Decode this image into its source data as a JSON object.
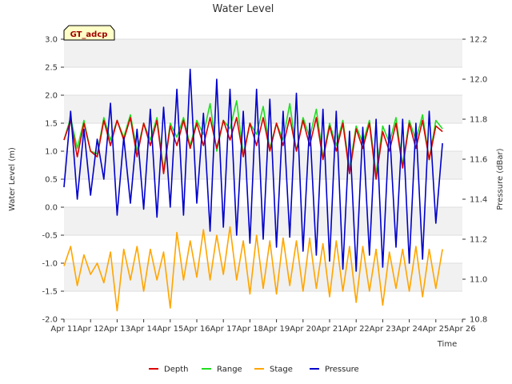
{
  "chart_data": {
    "type": "line",
    "title": "Water Level",
    "badge": "GT_adcp",
    "xlabel": "Time",
    "ylabel": "Water Level (m)",
    "y2label": "Pressure (dBar)",
    "ylim": [
      -2.0,
      3.0
    ],
    "y2lim": [
      10.8,
      12.2
    ],
    "xlim": [
      0,
      15
    ],
    "x_ticks": [
      "Apr 11",
      "Apr 12",
      "Apr 13",
      "Apr 14",
      "Apr 15",
      "Apr 16",
      "Apr 17",
      "Apr 18",
      "Apr 19",
      "Apr 20",
      "Apr 21",
      "Apr 22",
      "Apr 23",
      "Apr 24",
      "Apr 25",
      "Apr 26"
    ],
    "y_ticks": [
      "-2.0",
      "-1.5",
      "-1.0",
      "-0.5",
      "0.0",
      "0.5",
      "1.0",
      "1.5",
      "2.0",
      "2.5",
      "3.0"
    ],
    "y2_ticks": [
      "10.8",
      "11.0",
      "11.2",
      "11.4",
      "11.6",
      "11.8",
      "12.0",
      "12.2"
    ],
    "grid": "banded",
    "legend_position": "bottom",
    "series_x": [
      0.0,
      0.25,
      0.5,
      0.75,
      1.0,
      1.25,
      1.5,
      1.75,
      2.0,
      2.25,
      2.5,
      2.75,
      3.0,
      3.25,
      3.5,
      3.75,
      4.0,
      4.25,
      4.5,
      4.75,
      5.0,
      5.25,
      5.5,
      5.75,
      6.0,
      6.25,
      6.5,
      6.75,
      7.0,
      7.25,
      7.5,
      7.75,
      8.0,
      8.25,
      8.5,
      8.75,
      9.0,
      9.25,
      9.5,
      9.75,
      10.0,
      10.25,
      10.5,
      10.75,
      11.0,
      11.25,
      11.5,
      11.75,
      12.0,
      12.25,
      12.5,
      12.75,
      13.0,
      13.25,
      13.5,
      13.75,
      14.0,
      14.25
    ],
    "series": [
      {
        "name": "Depth",
        "color": "#dd0000",
        "values": [
          1.2,
          1.55,
          0.9,
          1.5,
          1.0,
          0.9,
          1.55,
          1.1,
          1.55,
          1.2,
          1.6,
          0.9,
          1.5,
          1.1,
          1.55,
          0.6,
          1.45,
          1.1,
          1.55,
          1.05,
          1.5,
          1.1,
          1.6,
          1.05,
          1.55,
          1.2,
          1.6,
          0.9,
          1.5,
          1.1,
          1.6,
          1.0,
          1.5,
          1.1,
          1.6,
          1.0,
          1.55,
          1.1,
          1.6,
          0.85,
          1.45,
          1.0,
          1.5,
          0.6,
          1.4,
          1.05,
          1.5,
          0.5,
          1.35,
          1.0,
          1.5,
          0.7,
          1.5,
          1.05,
          1.55,
          0.85,
          1.45,
          1.35
        ]
      },
      {
        "name": "Range",
        "color": "#22dd22",
        "values": [
          1.2,
          1.6,
          1.05,
          1.55,
          1.0,
          0.95,
          1.6,
          1.2,
          1.55,
          1.25,
          1.65,
          1.0,
          1.5,
          1.2,
          1.6,
          0.65,
          1.5,
          1.25,
          1.6,
          1.1,
          1.55,
          1.3,
          1.85,
          1.0,
          1.55,
          1.4,
          1.9,
          0.95,
          1.5,
          1.3,
          1.8,
          1.05,
          1.5,
          1.2,
          1.85,
          1.0,
          1.6,
          1.25,
          1.75,
          0.9,
          1.5,
          1.1,
          1.55,
          0.7,
          1.45,
          1.15,
          1.55,
          0.6,
          1.45,
          1.15,
          1.6,
          0.75,
          1.55,
          1.2,
          1.65,
          0.85,
          1.55,
          1.4
        ]
      },
      {
        "name": "Stage",
        "color": "#ffa500",
        "values": [
          -1.05,
          -0.7,
          -1.4,
          -0.85,
          -1.2,
          -1.0,
          -1.35,
          -0.8,
          -1.85,
          -0.75,
          -1.3,
          -0.7,
          -1.5,
          -0.75,
          -1.3,
          -0.8,
          -1.8,
          -0.45,
          -1.3,
          -0.6,
          -1.25,
          -0.4,
          -1.3,
          -0.5,
          -1.2,
          -0.35,
          -1.3,
          -0.6,
          -1.55,
          -0.5,
          -1.45,
          -0.6,
          -1.55,
          -0.55,
          -1.4,
          -0.6,
          -1.5,
          -0.55,
          -1.45,
          -0.65,
          -1.6,
          -0.6,
          -1.5,
          -0.7,
          -1.7,
          -0.7,
          -1.5,
          -0.75,
          -1.75,
          -0.8,
          -1.45,
          -0.75,
          -1.5,
          -0.7,
          -1.6,
          -0.75,
          -1.45,
          -0.75
        ]
      },
      {
        "name": "Pressure",
        "color": "#0000cc",
        "values": [
          11.46,
          11.84,
          11.4,
          11.75,
          11.42,
          11.7,
          11.5,
          11.88,
          11.32,
          11.71,
          11.38,
          11.75,
          11.35,
          11.85,
          11.31,
          11.86,
          11.36,
          11.95,
          11.32,
          12.05,
          11.38,
          11.83,
          11.24,
          12.0,
          11.26,
          11.95,
          11.22,
          11.84,
          11.18,
          11.95,
          11.2,
          11.9,
          11.16,
          11.84,
          11.21,
          11.93,
          11.14,
          11.78,
          11.12,
          11.85,
          11.09,
          11.84,
          11.05,
          11.74,
          11.04,
          11.76,
          11.12,
          11.8,
          11.06,
          11.77,
          11.16,
          11.8,
          11.08,
          11.78,
          11.1,
          11.84,
          11.28,
          11.68
        ]
      }
    ]
  }
}
